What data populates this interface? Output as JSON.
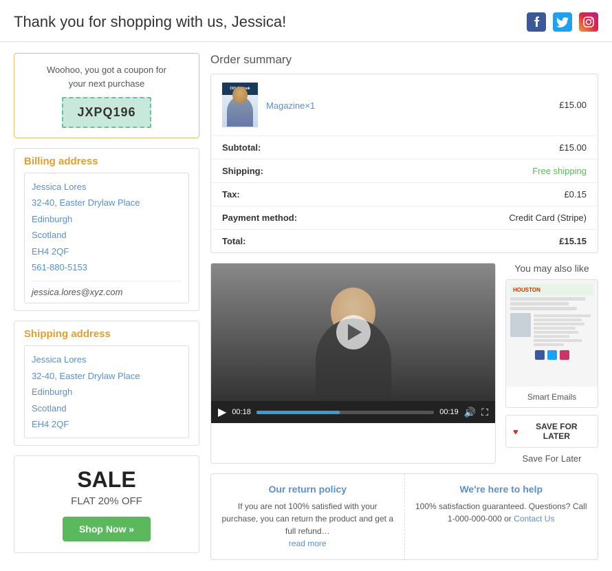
{
  "header": {
    "title": "Thank you for shopping with us, Jessica!",
    "social": {
      "fb": "f",
      "tw": "t",
      "ig": "♡"
    }
  },
  "coupon": {
    "text_line1": "Woohoo, you got a coupon for",
    "text_line2": "your next purchase",
    "code": "JXPQ196"
  },
  "billing": {
    "heading": "Billing address",
    "name": "Jessica Lores",
    "address1": "32-40, Easter Drylaw Place",
    "city": "Edinburgh",
    "region": "Scotland",
    "postcode": "EH4 2QF",
    "phone": "561-880-5153",
    "email": "jessica.lores@xyz.com"
  },
  "shipping": {
    "heading": "Shipping address",
    "name": "Jessica Lores",
    "address1": "32-40, Easter Drylaw Place",
    "city": "Edinburgh",
    "region": "Scotland",
    "postcode": "EH4 2QF"
  },
  "sale": {
    "title": "SALE",
    "subtitle": "FLAT 20% OFF",
    "btn": "Shop Now »"
  },
  "order_summary": {
    "title": "Order summary",
    "product_name": "Magazine",
    "product_qty": "×1",
    "product_price": "£15.00",
    "rows": [
      {
        "label": "Subtotal:",
        "value": "£15.00",
        "style": "normal"
      },
      {
        "label": "Shipping:",
        "value": "Free shipping",
        "style": "green"
      },
      {
        "label": "Tax:",
        "value": "£0.15",
        "style": "normal"
      },
      {
        "label": "Payment method:",
        "value": "Credit Card (Stripe)",
        "style": "normal"
      },
      {
        "label": "Total:",
        "value": "£15.15",
        "style": "total"
      }
    ]
  },
  "video": {
    "time_current": "00:18",
    "time_total": "00:19"
  },
  "you_may_like": {
    "title": "You may also like",
    "product_label": "Smart Emails",
    "save_btn": "SAVE FOR LATER",
    "save_label": "Save For Later"
  },
  "return_policy": {
    "title": "Our return policy",
    "text": "If you are not 100% satisfied with your purchase, you can return the product and get a full refund…",
    "read_more": "read more"
  },
  "help": {
    "title": "We're here to help",
    "text": "100% satisfaction guaranteed. Questions? Call 1-000-000-000 or ",
    "link": "Contact Us"
  }
}
